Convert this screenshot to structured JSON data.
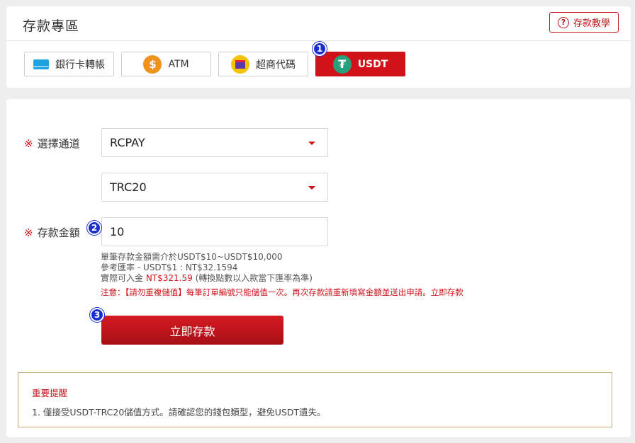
{
  "header": {
    "title": "存款專區",
    "help_label": "存款教學"
  },
  "tabs": [
    {
      "label": "銀行卡轉帳",
      "icon": "bank-card-icon"
    },
    {
      "label": "ATM",
      "icon": "coin-icon"
    },
    {
      "label": "超商代碼",
      "icon": "store-icon"
    },
    {
      "label": "USDT",
      "icon": "tether-icon",
      "active": true
    }
  ],
  "badges": [
    "1",
    "2",
    "3"
  ],
  "form": {
    "channel_label": "選擇通道",
    "required_mark": "※",
    "channel_value": "RCPAY",
    "network_value": "TRC20",
    "amount_label": "存款金額",
    "amount_value": "10",
    "hint_range": "單筆存款金額需介於USDT$10~USDT$10,000",
    "hint_rate": "參考匯率 - USDT$1 : NT$32.1594",
    "hint_actual_prefix": "實際可入金 ",
    "hint_actual_amount": "NT$321.59",
    "hint_actual_suffix": " (轉換點數以入款當下匯率為準)",
    "warning": "注意：【請勿重複儲值】每筆訂單編號只能儲值一次。再次存款請重新填寫金額並送出申請。立即存款",
    "submit_label": "立即存款"
  },
  "notice": {
    "title": "重要提醒",
    "items": [
      "1. 僅接受USDT-TRC20儲值方式。請確認您的錢包類型，避免USDT遺失。"
    ]
  },
  "colors": {
    "accent": "#d01219",
    "badge": "#1a2ecc",
    "tether": "#26a17b"
  }
}
